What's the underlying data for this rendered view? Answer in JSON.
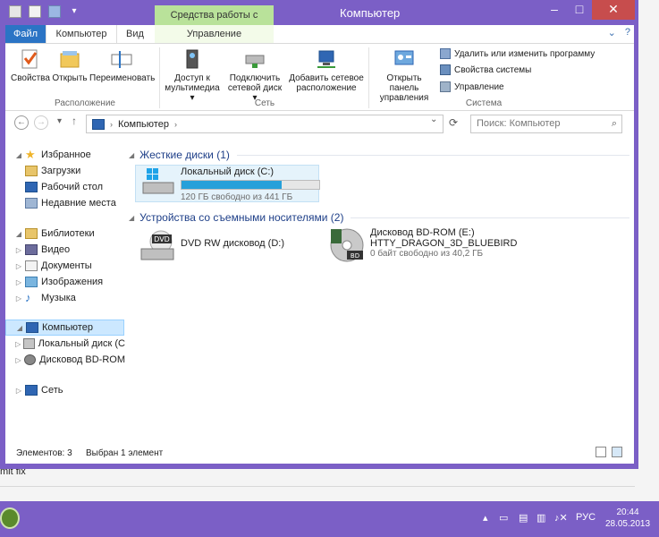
{
  "background": {
    "text": "mit fix"
  },
  "window": {
    "title": "Компьютер",
    "context_tab": "Средства работы с дисками",
    "controls": {
      "minimize": "–",
      "maximize": "□",
      "close": "✕"
    }
  },
  "tabs": {
    "file": "Файл",
    "computer": "Компьютер",
    "view": "Вид",
    "manage": "Управление"
  },
  "ribbon": {
    "buttons": {
      "properties": "Свойства",
      "open": "Открыть",
      "rename": "Переименовать",
      "media_access": "Доступ к мультимедиа ▾",
      "map_drive": "Подключить сетевой диск ▾",
      "add_network": "Добавить сетевое расположение",
      "control_panel": "Открыть панель управления"
    },
    "system_links": {
      "uninstall": "Удалить или изменить программу",
      "sys_props": "Свойства системы",
      "manage": "Управление"
    },
    "groups": {
      "location": "Расположение",
      "network": "Сеть",
      "system": "Система"
    }
  },
  "address": {
    "path": "Компьютер",
    "search_placeholder": "Поиск: Компьютер"
  },
  "nav": {
    "favorites": "Избранное",
    "downloads": "Загрузки",
    "desktop": "Рабочий стол",
    "recent": "Недавние места",
    "libraries": "Библиотеки",
    "video": "Видео",
    "documents": "Документы",
    "images": "Изображения",
    "music": "Музыка",
    "computer": "Компьютер",
    "local_disk": "Локальный диск (C",
    "bd_drive": "Дисковод BD-ROM",
    "network": "Сеть"
  },
  "content": {
    "hard_disks_header": "Жесткие диски (1)",
    "removable_header": "Устройства со съемными носителями (2)",
    "drives": {
      "c": {
        "name": "Локальный диск (C:)",
        "space": "120 ГБ свободно из 441 ГБ",
        "usage_fraction": 0.73
      },
      "dvd": {
        "name": "DVD RW дисковод (D:)",
        "label": "DVD"
      },
      "bd": {
        "name": "Дисковод BD-ROM (E:)",
        "volume": "HTTY_DRAGON_3D_BLUEBIRD",
        "space": "0 байт свободно из 40,2 ГБ",
        "label": "BD"
      }
    }
  },
  "status": {
    "items": "Элементов: 3",
    "selected": "Выбран 1 элемент"
  },
  "taskbar": {
    "lang": "РУС",
    "time": "20:44",
    "date": "28.05.2013"
  }
}
